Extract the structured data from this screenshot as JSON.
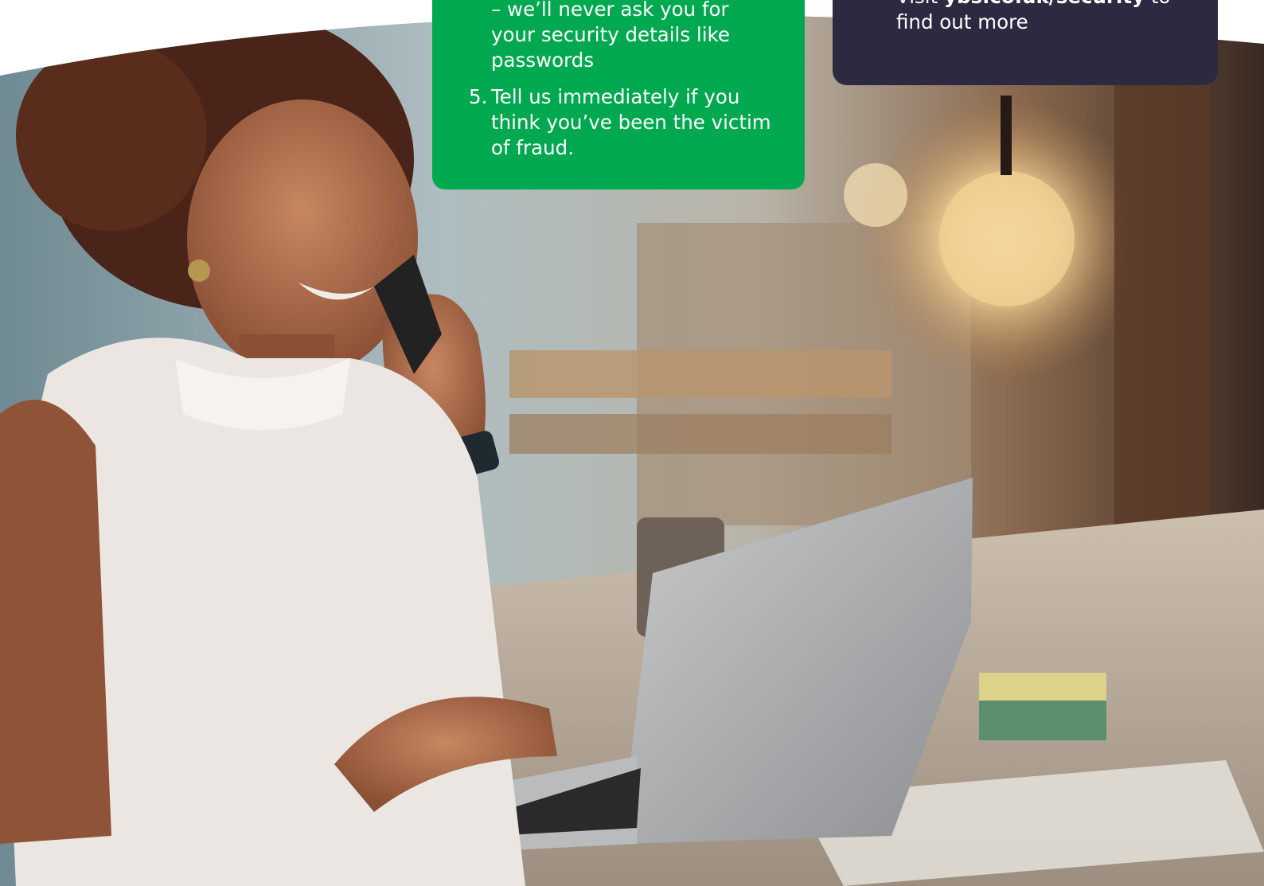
{
  "tips": {
    "items": [
      {
        "number": "",
        "lines": [
          "",
          "– we’ll never ask you for",
          "your security details like",
          "passwords"
        ]
      },
      {
        "number": "5.",
        "lines": [
          "Tell us immediately if you",
          "think you’ve been the victim",
          "of fraud."
        ]
      }
    ]
  },
  "info": {
    "visit_prefix": "Visit",
    "link": "ybs.co.uk/security",
    "visit_suffix": "to",
    "line2": "find out more"
  },
  "colors": {
    "green": "#00a94f",
    "navy": "#2d2940"
  }
}
